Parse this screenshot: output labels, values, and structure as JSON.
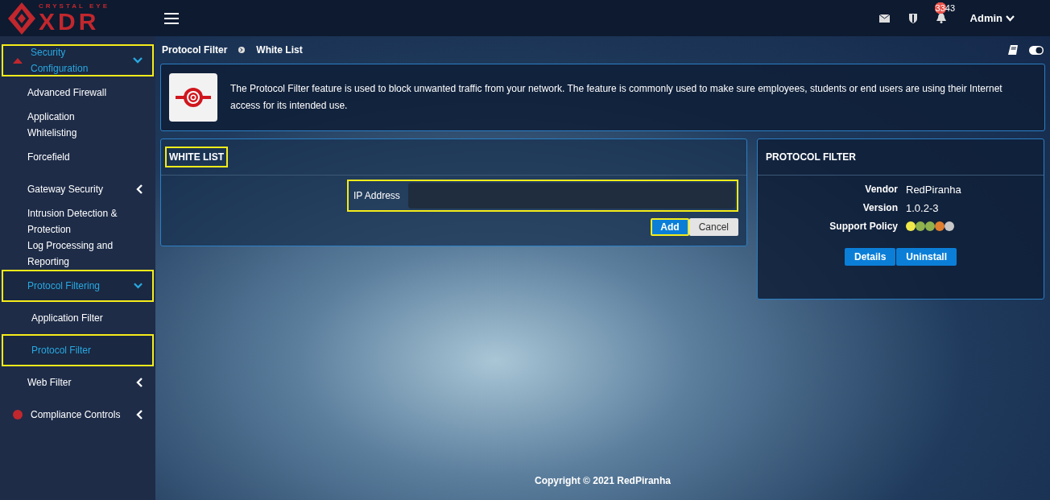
{
  "logo": {
    "top": "CRYSTAL EYE",
    "main": "XDR"
  },
  "topbar": {
    "notification_count": "3343",
    "user": "Admin"
  },
  "sidebar": {
    "items": [
      {
        "label": "Security Configuration",
        "expanded": true,
        "selected": true,
        "highlighted": true,
        "children": [
          {
            "label": "Advanced Firewall",
            "kind": "link",
            "selected": false,
            "highlighted": false
          },
          {
            "label": "Application Whitelisting",
            "kind": "link",
            "selected": false,
            "highlighted": false
          },
          {
            "label": "Forcefield",
            "kind": "link",
            "selected": false,
            "highlighted": false
          },
          {
            "label": "Gateway Security",
            "kind": "group",
            "expanded": false,
            "selected": false,
            "highlighted": false
          },
          {
            "label": "Intrusion Detection & Protection",
            "kind": "link",
            "selected": false,
            "highlighted": false
          },
          {
            "label": "Log Processing and Reporting",
            "kind": "link",
            "selected": false,
            "highlighted": false
          },
          {
            "label": "Protocol Filtering",
            "kind": "group",
            "expanded": true,
            "selected": true,
            "highlighted": true,
            "children": [
              {
                "label": "Application Filter",
                "selected": false,
                "highlighted": false
              },
              {
                "label": "Protocol Filter",
                "selected": true,
                "highlighted": true
              }
            ]
          },
          {
            "label": "Web Filter",
            "kind": "group",
            "expanded": false,
            "selected": false,
            "highlighted": false
          }
        ]
      },
      {
        "label": "Compliance Controls",
        "expanded": false,
        "selected": false,
        "highlighted": false
      }
    ]
  },
  "breadcrumb": [
    "Protocol Filter",
    "White List"
  ],
  "info": {
    "text": "The Protocol Filter feature is used to block unwanted traffic from your network. The feature is commonly used to make sure employees, students or end users are using their Internet access for its intended use."
  },
  "white_list": {
    "title": "WHITE LIST",
    "title_highlighted": true,
    "field_label": "IP Address",
    "field_highlighted": true,
    "buttons": [
      {
        "label": "Add",
        "kind": "primary",
        "highlighted": true
      },
      {
        "label": "Cancel",
        "kind": "secondary",
        "highlighted": false
      }
    ]
  },
  "protocol_filter": {
    "title": "PROTOCOL FILTER",
    "rows": [
      {
        "label": "Vendor",
        "value": "RedPiranha"
      },
      {
        "label": "Version",
        "value": "1.0.2-3"
      }
    ],
    "support_label": "Support Policy",
    "support_dots": [
      {
        "color": "#f0e84a"
      },
      {
        "color": "#8fb24d"
      },
      {
        "color": "#8fb24d"
      },
      {
        "color": "#e07f2e"
      },
      {
        "color": "#c8c8c8"
      }
    ],
    "buttons": [
      "Details",
      "Uninstall"
    ]
  },
  "footer": "Copyright © 2021 RedPiranha"
}
